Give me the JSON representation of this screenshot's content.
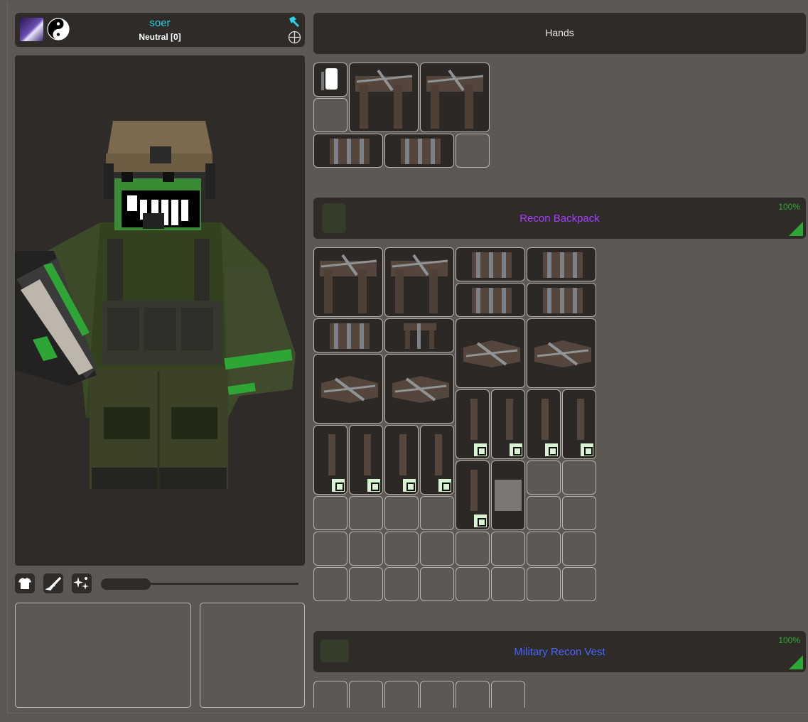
{
  "player": {
    "name": "soer",
    "reputation": "Neutral [0]"
  },
  "hands": {
    "title": "Hands"
  },
  "backpack": {
    "title": "Recon Backpack",
    "durability": "100%"
  },
  "vest": {
    "title": "Military Recon Vest",
    "durability": "100%"
  },
  "icons": {
    "avatar": "avatar-icon",
    "faction": "yin-yang-icon",
    "build": "hammer-icon",
    "target": "crosshair-icon",
    "tab_clothing": "shirt-icon",
    "tab_weapons": "rifle-icon",
    "tab_skills": "sparkle-icon"
  },
  "colors": {
    "name": "#2ad3e6",
    "backpack_title": "#a640ff",
    "vest_title": "#4a63ff",
    "durability": "#36a93c",
    "panel": "#2e2b29",
    "background": "#5d5853"
  },
  "character_preview": {
    "zoom_slider_value": 0.25
  }
}
